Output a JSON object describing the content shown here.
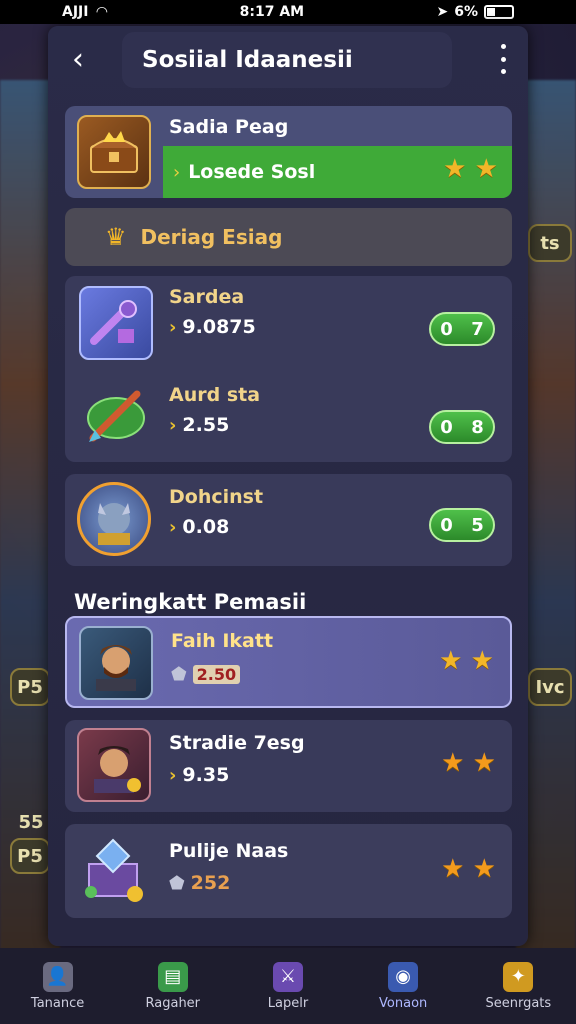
{
  "status_bar": {
    "carrier": "AJJI",
    "time": "8:17 AM",
    "battery": "6%"
  },
  "header": {
    "title": "Sosiial Idaanesii"
  },
  "featured": {
    "name": "Sadia Peag",
    "status": "Losede Sosl",
    "stars": "★ ★"
  },
  "banner": {
    "label": "Deriag Esiag"
  },
  "list_rows": [
    {
      "name": "Sardea",
      "value": "9.0875",
      "badge_left": "0",
      "badge_right": "7"
    },
    {
      "name": "Aurd sta",
      "value": "2.55",
      "badge_left": "0",
      "badge_right": "8"
    },
    {
      "name": "Dohcinst",
      "value": "0.08",
      "badge_left": "0",
      "badge_right": "5"
    }
  ],
  "section_title": "Weringkatt Pemasii",
  "ranking": [
    {
      "name": "Faih Ikatt",
      "value": "2.50",
      "stars": "★ ★"
    },
    {
      "name": "Stradie 7esg",
      "value": "9.35",
      "stars": "★ ★"
    },
    {
      "name": "Pulije Naas",
      "value": "252",
      "stars": "★ ★"
    }
  ],
  "nav": [
    {
      "label": "Tanance"
    },
    {
      "label": "Ragaher"
    },
    {
      "label": "Lapelr"
    },
    {
      "label": "Vonaon"
    },
    {
      "label": "Seenrgats"
    }
  ],
  "bg_chips": {
    "left_1": "P5",
    "left_2": "P5",
    "left_3": "55",
    "right_1": "Ivc",
    "right_2": "ts"
  },
  "colors": {
    "accent_green": "#3fae3c",
    "star_gold": "#f2b628",
    "panel": "#2a2b48"
  },
  "icons": {
    "back": "chevron-left-icon",
    "more": "more-vertical-icon",
    "chest": "treasure-chest-icon",
    "crown": "crown-icon",
    "game": "game-thumb-icon"
  }
}
